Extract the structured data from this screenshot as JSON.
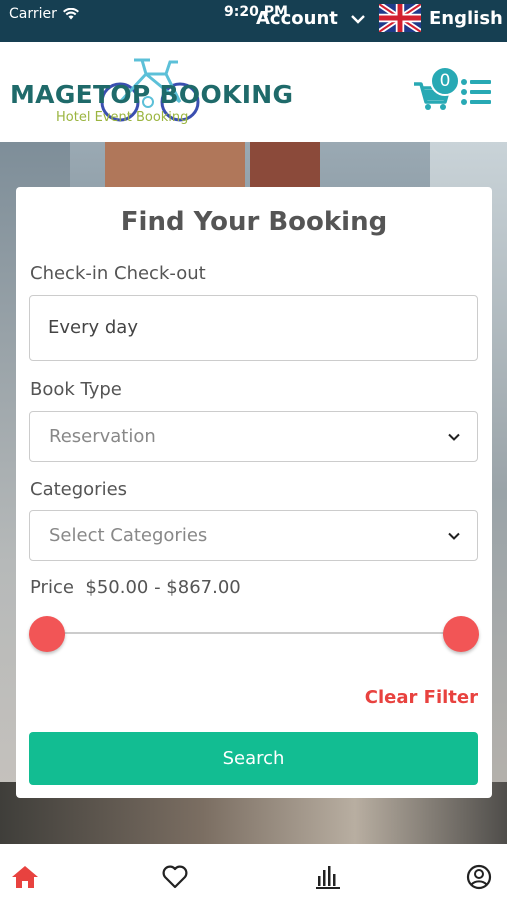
{
  "status": {
    "carrier": "Carrier",
    "time": "9:20 PM"
  },
  "topbar": {
    "account_label": "Account",
    "language_label": "English"
  },
  "header": {
    "logo_title": "MAGETOP BOOKING",
    "logo_subtitle": "Hotel Event Booking",
    "cart_count": "0"
  },
  "form": {
    "title": "Find Your Booking",
    "checkin_label": "Check-in Check-out",
    "checkin_value": "Every day",
    "book_type_label": "Book Type",
    "book_type_value": "Reservation",
    "categories_label": "Categories",
    "categories_placeholder": "Select Categories",
    "price_label": "Price",
    "price_range": "$50.00 - $867.00",
    "price_min_fraction": 0,
    "price_max_fraction": 1,
    "clear_filter_label": "Clear Filter",
    "search_label": "Search"
  },
  "colors": {
    "accent": "#12bd92",
    "danger": "#e8423f",
    "topbar": "#163f52",
    "active_nav": "#e8423f"
  },
  "bottom_nav": [
    {
      "icon": "home-icon",
      "active": true
    },
    {
      "icon": "heart-icon",
      "active": false
    },
    {
      "icon": "chart-icon",
      "active": false
    },
    {
      "icon": "account-icon",
      "active": false
    }
  ]
}
